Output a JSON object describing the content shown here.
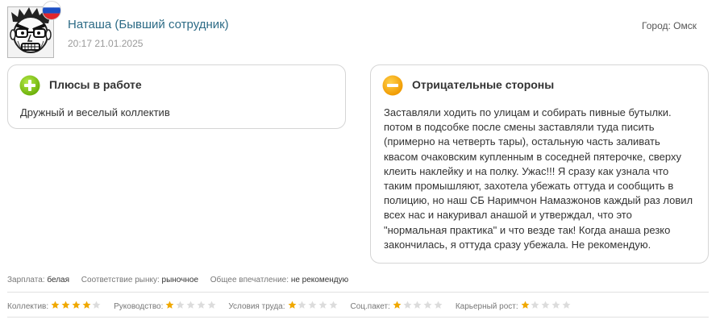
{
  "review": {
    "author": "Наташа (Бывший сотрудник)",
    "datetime": "20:17 21.01.2025",
    "city": "Город: Омск",
    "avatar_icon": "angry-face-avatar-icon",
    "flag_icon": "russia-flag-icon"
  },
  "pros": {
    "title": "Плюсы в работе",
    "text": "Дружный и веселый коллектив",
    "icon": "plus-circle-icon",
    "color": "#7cc10a"
  },
  "cons": {
    "title": "Отрицательные стороны",
    "text": "Заставляли ходить по улицам и собирать пивные бутылки. потом в подсобке после смены заставляли туда писить (примерно на четверть тары), остальную часть заливать квасом очаковским купленным в соседней пятерочке, сверху клеить наклейку и на полку. Ужас!!! Я сразу как узнала что таким промышляют, захотела убежать оттуда и сообщить в полицию, но наш СБ Наримчон Намазжонов каждый раз ловил всех нас и накуривал анашой и утверждал, что это \"нормальная практика\" и что везде так! Когда анаша резко закончилась, я оттуда сразу убежала. Не рекомендую.",
    "icon": "minus-circle-icon",
    "color": "#f2a900"
  },
  "meta": {
    "salary_label": "Зарплата:",
    "salary_value": "белая",
    "market_label": "Соответствие рынку:",
    "market_value": "рыночное",
    "impression_label": "Общее впечатление:",
    "impression_value": "не рекомендую"
  },
  "ratings": [
    {
      "label": "Коллектив:",
      "value": 4,
      "max": 5
    },
    {
      "label": "Руководство:",
      "value": 1,
      "max": 5
    },
    {
      "label": "Условия труда:",
      "value": 1,
      "max": 5
    },
    {
      "label": "Соц.пакет:",
      "value": 1,
      "max": 5
    },
    {
      "label": "Карьерный рост:",
      "value": 1,
      "max": 5
    }
  ],
  "colors": {
    "author": "#2d6b86",
    "star_filled": "#f0a800",
    "star_empty": "#dcdcdc"
  }
}
